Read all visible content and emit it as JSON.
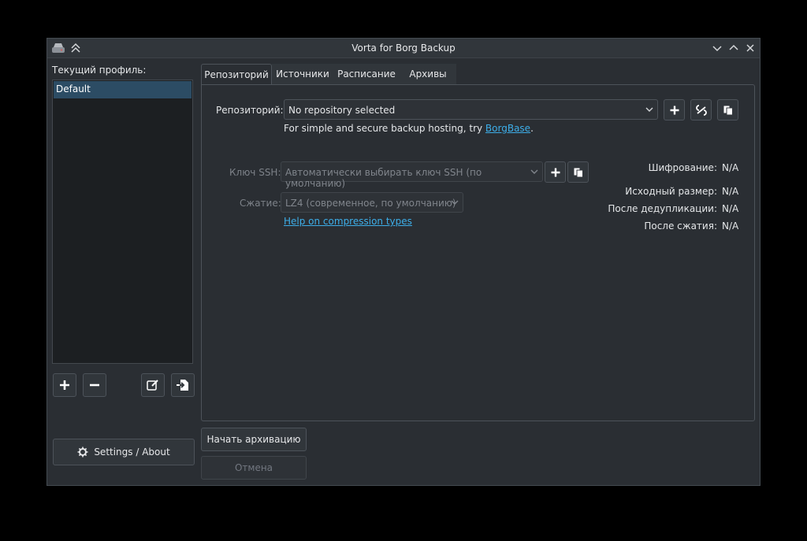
{
  "window": {
    "title": "Vorta for Borg Backup",
    "controls": [
      "minimize",
      "maximize",
      "close"
    ]
  },
  "sidebar": {
    "profile_label": "Текущий профиль:",
    "profiles": [
      "Default"
    ],
    "settings_label": "Settings / About"
  },
  "tabs": [
    "Репозиторий",
    "Источники",
    "Расписание",
    "Архивы"
  ],
  "repo": {
    "label": "Репозиторий:",
    "selected": "No repository selected",
    "hint_prefix": "For simple and secure backup hosting, try ",
    "hint_link": "BorgBase",
    "hint_suffix": "."
  },
  "ssh": {
    "label": "Ключ SSH:",
    "value": "Автоматически выбирать ключ SSH (по умолчанию)"
  },
  "compression": {
    "label": "Сжатие:",
    "value": "LZ4 (современное, по умолчанию)",
    "help_link": "Help on compression types"
  },
  "stats": {
    "encryption_label": "Шифрование:",
    "encryption_value": "N/A",
    "original_label": "Исходный размер:",
    "original_value": "N/A",
    "dedup_label": "После дедупликации:",
    "dedup_value": "N/A",
    "compressed_label": "После сжатия:",
    "compressed_value": "N/A"
  },
  "actions": {
    "start": "Начать архивацию",
    "cancel": "Отмена"
  },
  "colors": {
    "background": "#2a2e33",
    "selection": "#2c4c64",
    "link": "#3daee9"
  }
}
